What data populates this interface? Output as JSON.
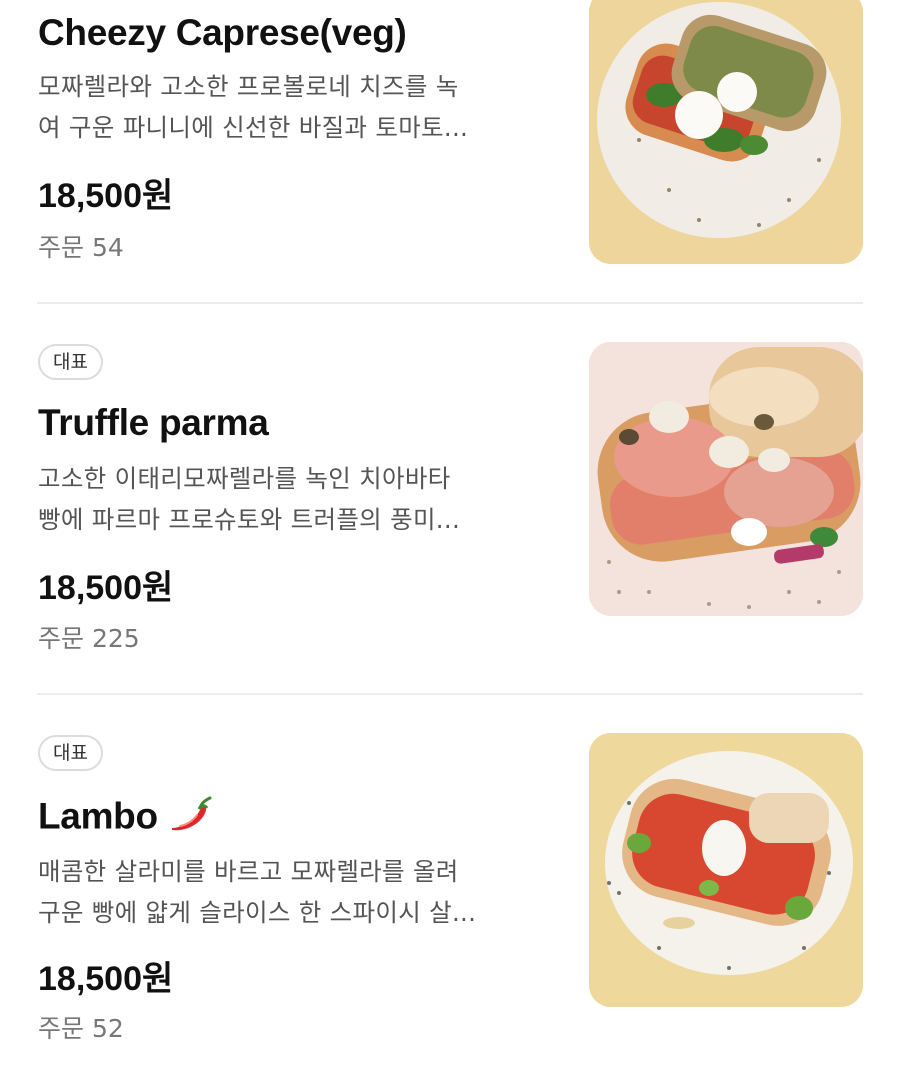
{
  "menu": {
    "items": [
      {
        "badge": "",
        "title": "Cheezy Caprese(veg)",
        "desc_line1": "모짜렐라와 고소한 프로볼로네 치즈를 녹",
        "desc_line2": "여 구운 파니니에 신선한 바질과 토마토...",
        "price": "18,500원",
        "orders": "주문 54",
        "photo_bg": "#f0d9a0"
      },
      {
        "badge": "대표",
        "title": "Truffle parma",
        "desc_line1": "고소한 이태리모짜렐라를 녹인 치아바타",
        "desc_line2": "빵에 파르마 프로슈토와 트러플의 풍미...",
        "price": "18,500원",
        "orders": "주문 225",
        "photo_bg": "#f3e3dc"
      },
      {
        "badge": "대표",
        "title": "Lambo",
        "title_icon": "chili-pepper-icon",
        "desc_line1": "매콤한 살라미를 바르고 모짜렐라를 올려",
        "desc_line2": "구운 빵에 얇게 슬라이스 한 스파이시 살...",
        "price": "18,500원",
        "orders": "주문 52",
        "photo_bg": "#efd89c"
      }
    ]
  }
}
